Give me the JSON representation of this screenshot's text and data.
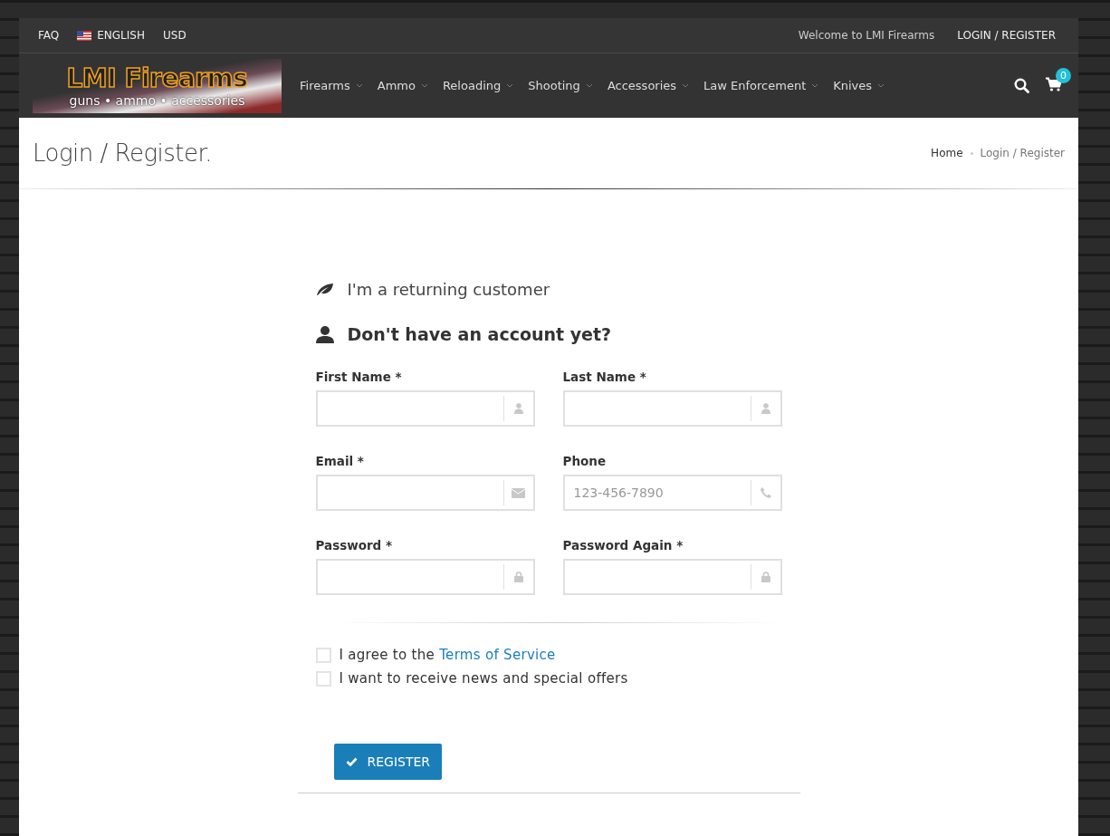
{
  "top_bar": {
    "left": [
      {
        "kind": "link",
        "label": "FAQ"
      },
      {
        "kind": "language",
        "label": "ENGLISH"
      },
      {
        "kind": "link",
        "label": "USD"
      }
    ],
    "welcome": "Welcome to LMI Firearms",
    "login": "LOGIN / REGISTER"
  },
  "logo": {
    "title": "LMI Firearms",
    "tagline": "guns • ammo • accessories"
  },
  "nav": [
    "Firearms",
    "Ammo",
    "Reloading",
    "Shooting",
    "Accessories",
    "Law Enforcement",
    "Knives"
  ],
  "cart": {
    "count": "0"
  },
  "page_title": "Login / Register.",
  "breadcrumb": [
    "Home",
    "Login / Register"
  ],
  "returning": "I'm a returning customer",
  "register_heading": "Don't have an account yet?",
  "fields": [
    {
      "label": "First Name *",
      "kind": "name"
    },
    {
      "label": "Last Name *",
      "kind": "name"
    },
    {
      "label": "Email *",
      "kind": "email"
    },
    {
      "label": "Phone",
      "kind": "phone",
      "placeholder": "123-456-7890"
    },
    {
      "label": "Password *",
      "kind": "password"
    },
    {
      "label": "Password Again *",
      "kind": "password"
    }
  ],
  "checkboxes": [
    {
      "text": "I agree to the",
      "link": "Terms of Service",
      "checked": false
    },
    {
      "text": "I want to receive news and special offers",
      "checked": false
    }
  ],
  "register_button": "REGISTER"
}
